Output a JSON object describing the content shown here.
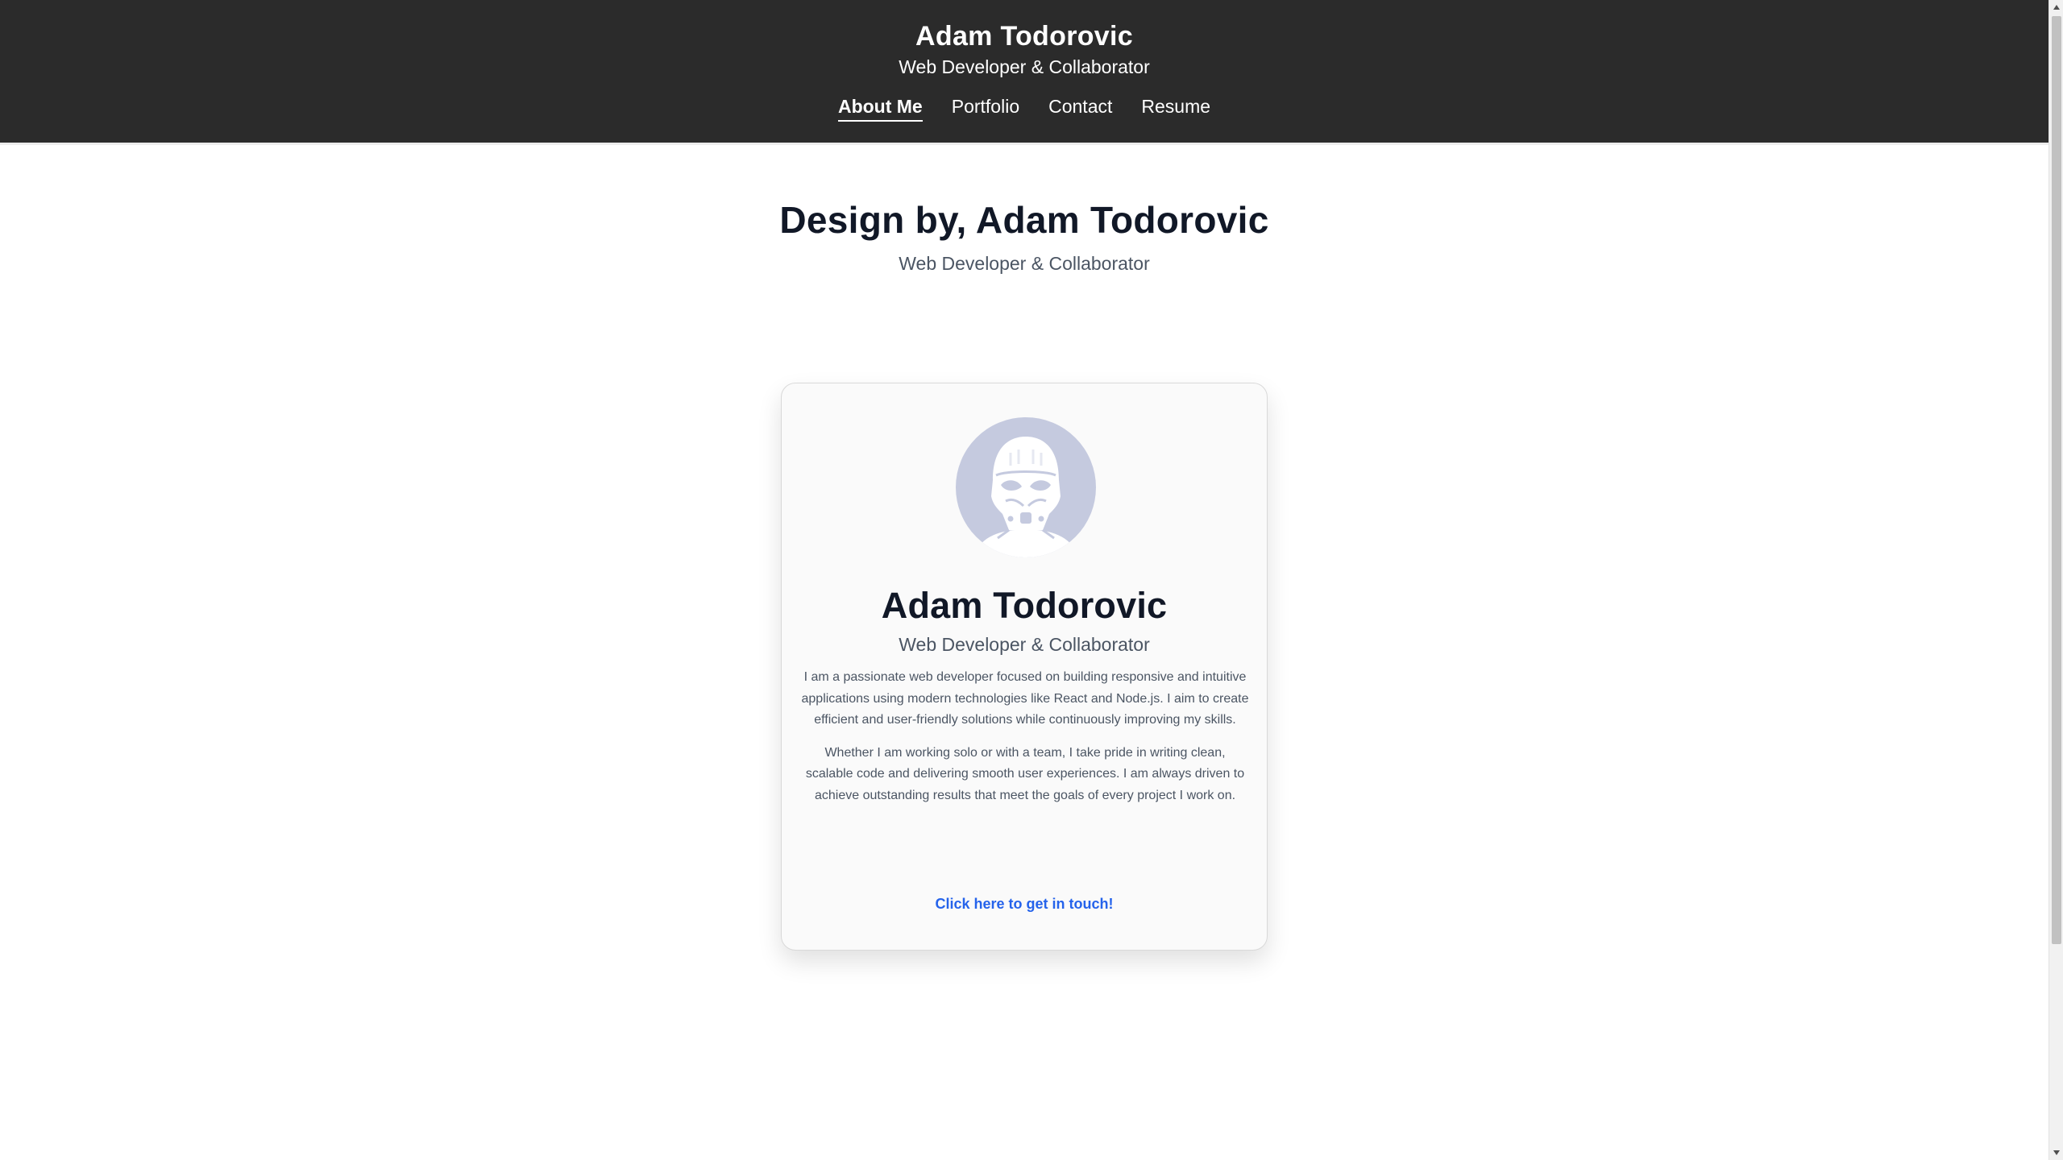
{
  "header": {
    "title": "Adam Todorovic",
    "subtitle": "Web Developer & Collaborator",
    "nav": [
      {
        "label": "About Me",
        "active": true
      },
      {
        "label": "Portfolio",
        "active": false
      },
      {
        "label": "Contact",
        "active": false
      },
      {
        "label": "Resume",
        "active": false
      }
    ]
  },
  "hero": {
    "title": "Design by, Adam Todorovic",
    "subtitle": "Web Developer & Collaborator"
  },
  "card": {
    "avatar_icon": "stormtrooper-helmet-icon",
    "name": "Adam Todorovic",
    "role": "Web Developer & Collaborator",
    "bio": [
      "I am a passionate web developer focused on building responsive and intuitive applications using modern technologies like React and Node.js. I aim to create efficient and user-friendly solutions while continuously improving my skills.",
      "Whether I am working solo or with a team, I take pride in writing clean, scalable code and delivering smooth user experiences. I am always driven to achieve outstanding results that meet the goals of every project I work on."
    ],
    "cta": "Click here to get in touch!"
  },
  "colors": {
    "header_bg": "#2b2b2b",
    "avatar_bg": "#c5cadf",
    "link": "#2563eb",
    "heading": "#111827",
    "muted": "#4b5563"
  }
}
